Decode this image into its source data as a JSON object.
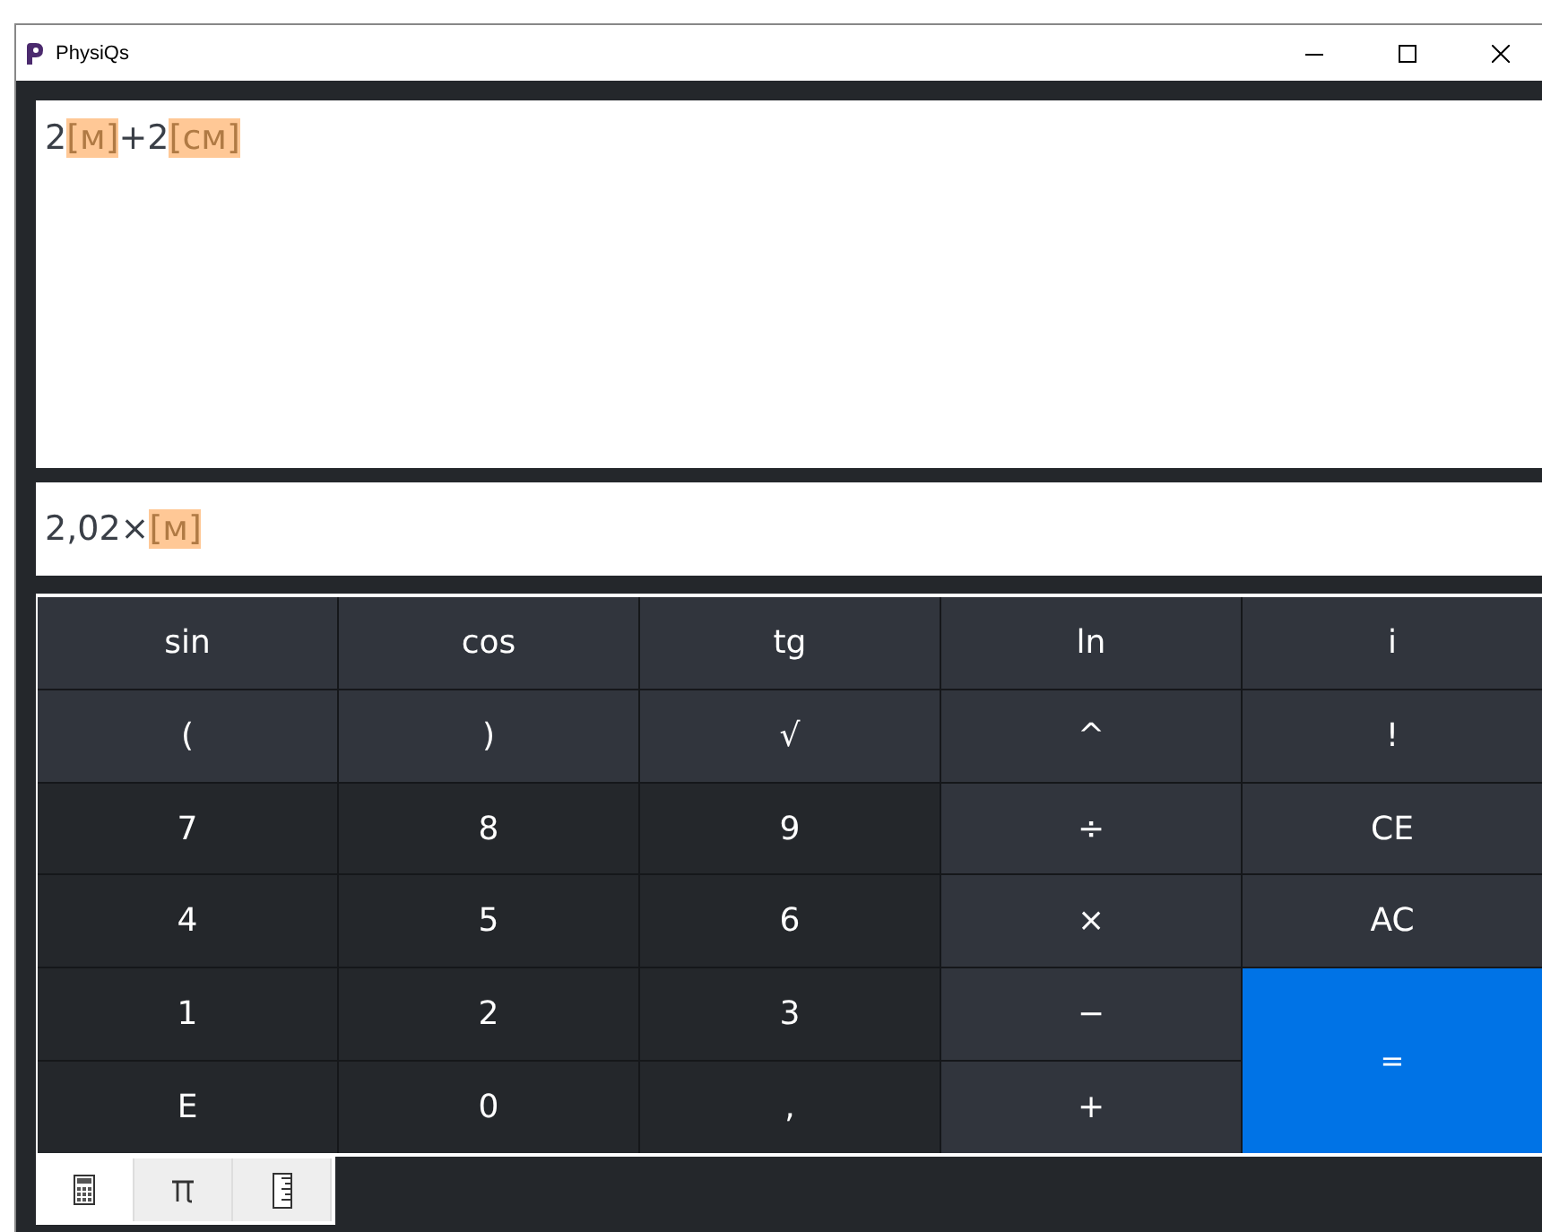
{
  "window": {
    "title": "PhysiQs"
  },
  "expression": [
    {
      "text": "2",
      "kind": "number"
    },
    {
      "text": "[м]",
      "kind": "unit"
    },
    {
      "text": "+2",
      "kind": "number"
    },
    {
      "text": "[см]",
      "kind": "unit"
    }
  ],
  "result": [
    {
      "text": "2,02×",
      "kind": "number"
    },
    {
      "text": "[м]",
      "kind": "unit"
    }
  ],
  "keys": [
    {
      "label": "sin",
      "kind": "function"
    },
    {
      "label": "cos",
      "kind": "function"
    },
    {
      "label": "tg",
      "kind": "function"
    },
    {
      "label": "ln",
      "kind": "function"
    },
    {
      "label": "i",
      "kind": "function"
    },
    {
      "label": "(",
      "kind": "function"
    },
    {
      "label": ")",
      "kind": "function"
    },
    {
      "label": "√",
      "kind": "function"
    },
    {
      "label": "^",
      "kind": "function"
    },
    {
      "label": "!",
      "kind": "function"
    },
    {
      "label": "7",
      "kind": "digit"
    },
    {
      "label": "8",
      "kind": "digit"
    },
    {
      "label": "9",
      "kind": "digit"
    },
    {
      "label": "÷",
      "kind": "function"
    },
    {
      "label": "CE",
      "kind": "function"
    },
    {
      "label": "4",
      "kind": "digit"
    },
    {
      "label": "5",
      "kind": "digit"
    },
    {
      "label": "6",
      "kind": "digit"
    },
    {
      "label": "×",
      "kind": "function"
    },
    {
      "label": "AC",
      "kind": "function"
    },
    {
      "label": "1",
      "kind": "digit"
    },
    {
      "label": "2",
      "kind": "digit"
    },
    {
      "label": "3",
      "kind": "digit"
    },
    {
      "label": "−",
      "kind": "function"
    },
    {
      "label": "=",
      "kind": "equals"
    },
    {
      "label": "E",
      "kind": "digit"
    },
    {
      "label": "0",
      "kind": "digit"
    },
    {
      "label": ",",
      "kind": "digit"
    },
    {
      "label": "+",
      "kind": "function"
    }
  ],
  "tabs": [
    {
      "kind": "calculator",
      "selected": true
    },
    {
      "kind": "constants",
      "selected": false
    },
    {
      "kind": "units",
      "selected": false
    }
  ]
}
